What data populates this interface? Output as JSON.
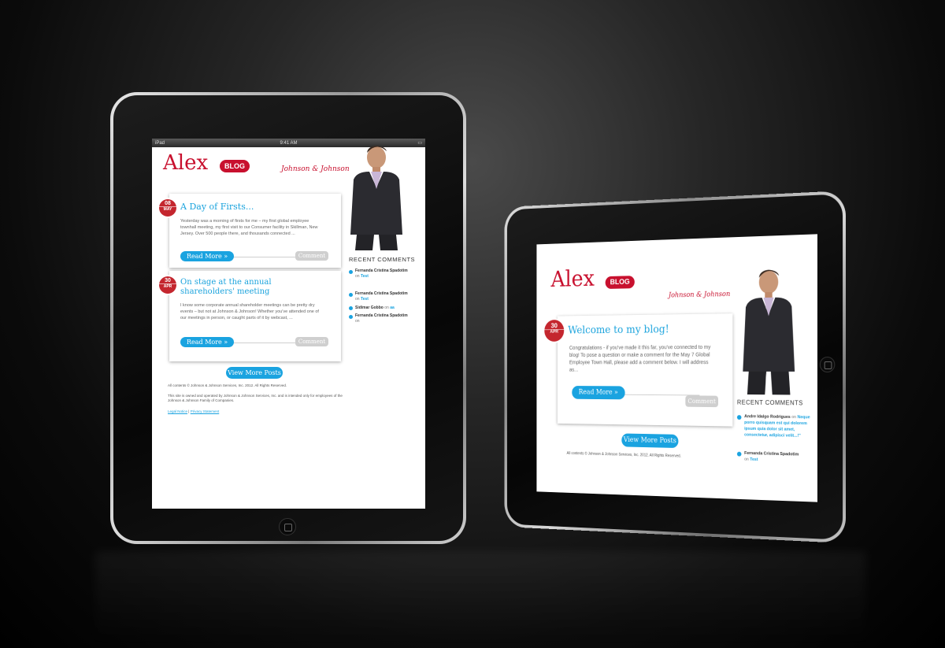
{
  "status_bar": {
    "carrier": "iPad",
    "time": "9:41 AM"
  },
  "blog": {
    "brand": "Alex",
    "badge": "BLOG",
    "company": "Johnson & Johnson"
  },
  "portrait": {
    "posts": [
      {
        "day": "08",
        "month": "MAY",
        "title": "A Day of Firsts...",
        "excerpt": "Yesterday was a morning of firsts for me – my first global employee townhall meeting, my first visit to our Consumer facility in Skillman, New Jersey. Over 500 people there, and thousands connected ..."
      },
      {
        "day": "30",
        "month": "APR",
        "title": "On stage at the annual shareholders' meeting",
        "excerpt": "I know some corporate annual shareholder meetings can be pretty dry events – but not at Johnson & Johnson! Whether you've attended one of our meetings in person, or caught parts of it by webcast, ..."
      }
    ],
    "read_more": "Read More »",
    "comment": "Comment",
    "view_more": "View More Posts",
    "recent_comments_title": "RECENT COMMENTS",
    "comments": [
      {
        "author": "Fernanda Cristina Spadotim",
        "on": "on",
        "post": "Test"
      },
      {
        "author": "Fernanda Cristina Spadotim",
        "on": "on",
        "post": "Test"
      },
      {
        "author": "Sidimar Gobbo",
        "on": "on",
        "post": "aa"
      },
      {
        "author": "Fernanda Cristina Spadotim",
        "on": "on",
        "post": ""
      }
    ],
    "footer": {
      "copyright": "All contents © Johnson & Johnson Services, Inc. 2012. All Rights Reserved.",
      "notice": "This site is owned and operated by Johnson & Johnson Services, Inc. and is intended only for employees of the Johnson & Johnson Family of Companies.",
      "legal": "Legal Notice",
      "separator": "|",
      "privacy": "Privacy Statement"
    }
  },
  "landscape": {
    "post": {
      "day": "30",
      "month": "APR",
      "title": "Welcome to my blog!",
      "excerpt": "Congratulations - if you've made it this far, you've connected to my blog! To pose a question or make a comment for the May 7 Global Employee Town Hall, please add a comment below. I will address as..."
    },
    "read_more": "Read More »",
    "comment": "Comment",
    "view_more": "View More Posts",
    "copyright": "All contents © Johnson & Johnson Services, Inc. 2012. All Rights Reserved.",
    "recent_comments_title": "RECENT COMMENTS",
    "comments": [
      {
        "author": "Andre Idalgo Rodrigues",
        "on": "on",
        "post": "Neque porro quisquam est qui dolorem ipsum quia dolor sit amet, consectetur, adipisci velit...!\""
      },
      {
        "author": "Fernanda Cristina Spadotim",
        "on": "on",
        "post": "Test"
      }
    ]
  },
  "colors": {
    "brand_red": "#c8102e",
    "link_blue": "#1aa3e0"
  }
}
